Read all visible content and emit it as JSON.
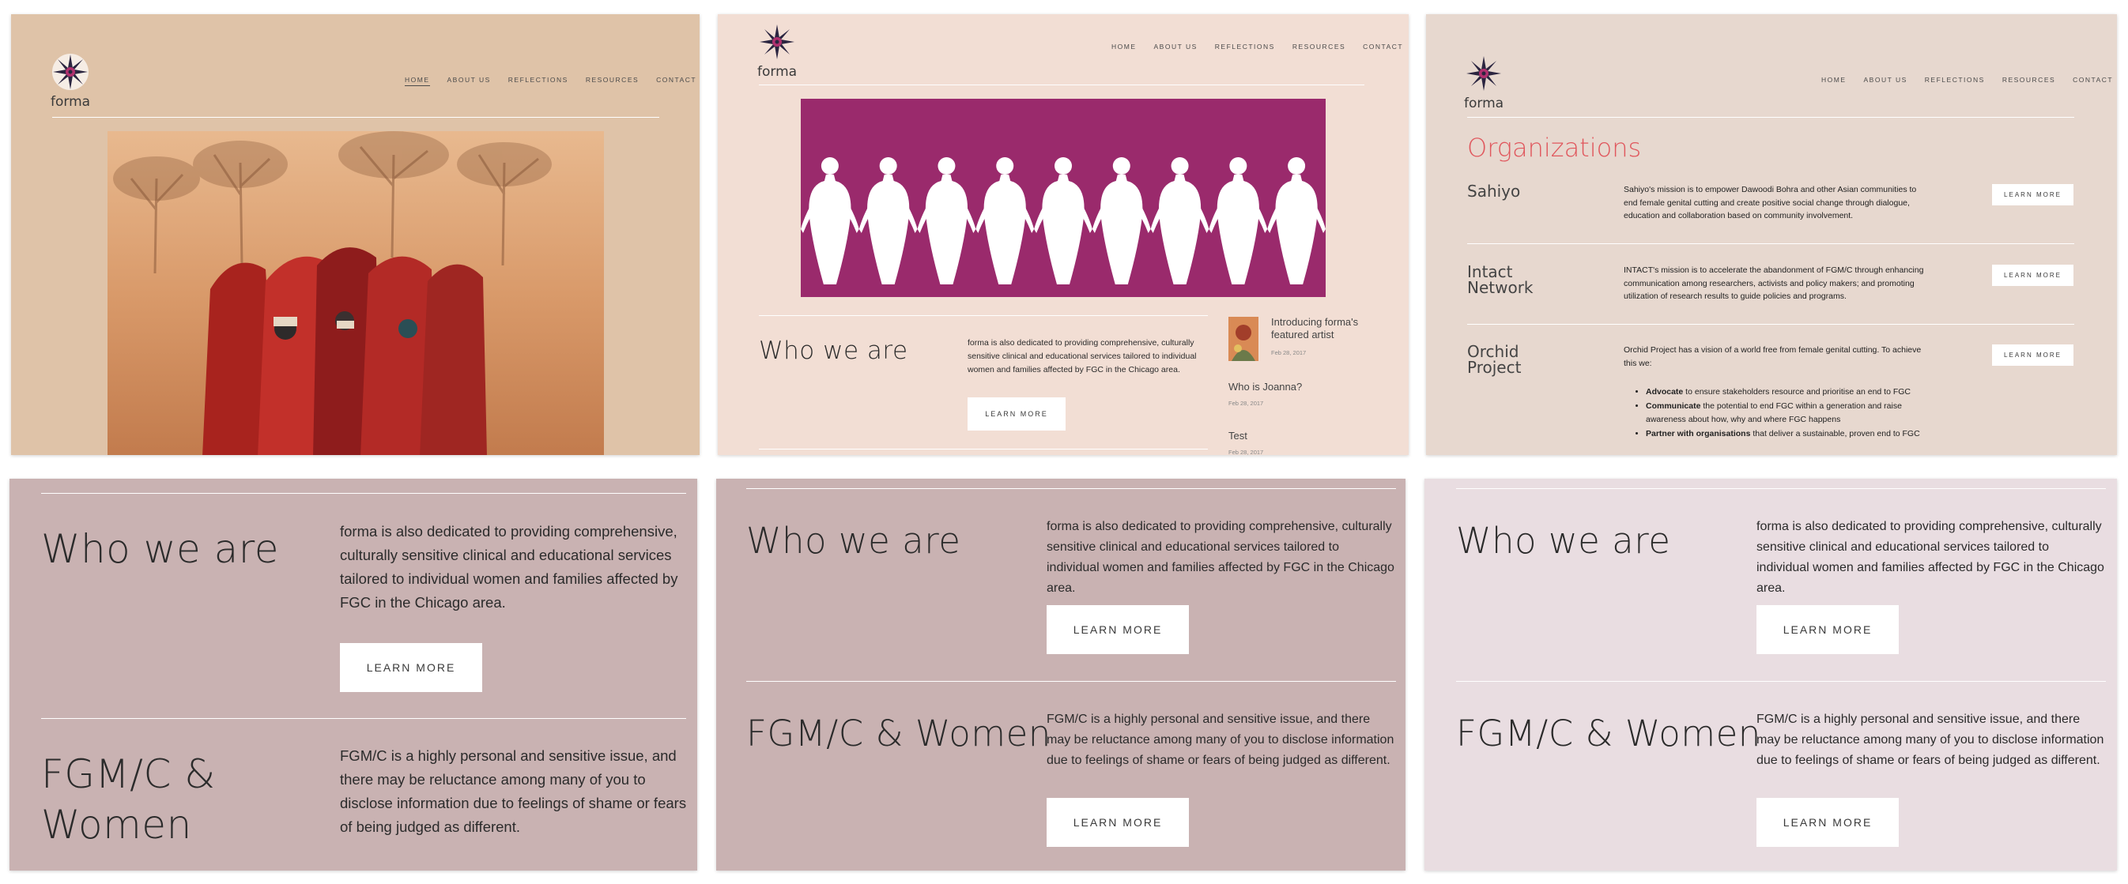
{
  "site": {
    "logo_text": "forma"
  },
  "nav": [
    "HOME",
    "ABOUT US",
    "REFLECTIONS",
    "RESOURCES",
    "CONTACT"
  ],
  "panel2": {
    "who_title": "Who we are",
    "who_body": "forma is also dedicated to providing comprehensive, culturally sensitive clinical and educational services tailored to individual women and families affected by FGC in the Chicago area.",
    "learn_more": "LEARN MORE",
    "posts": [
      {
        "title": "Introducing forma's featured artist",
        "date": "Feb 28, 2017"
      },
      {
        "title": "Who is Joanna?",
        "date": "Feb 28, 2017"
      },
      {
        "title": "Test",
        "date": "Feb 28, 2017"
      }
    ]
  },
  "panel3": {
    "title": "Organizations",
    "learn_more": "LEARN MORE",
    "orgs": [
      {
        "name_line1": "Sahiyo",
        "name_line2": "",
        "desc": "Sahiyo's mission is to empower Dawoodi Bohra and other Asian communities to end female genital cutting and create positive social change through dialogue, education and collaboration based on community involvement."
      },
      {
        "name_line1": "Intact",
        "name_line2": "Network",
        "desc": "INTACT's mission is to accelerate the abandonment of FGM/C through enhancing communication among researchers, activists and policy makers; and promoting utilization of research results to guide policies and programs."
      },
      {
        "name_line1": "Orchid",
        "name_line2": "Project",
        "desc": "Orchid Project has a vision of a world free from female genital cutting. To achieve this we:"
      }
    ],
    "bullets": [
      {
        "bold": "Advocate",
        "rest": " to ensure stakeholders resource and prioritise an end to FGC"
      },
      {
        "bold": "Communicate",
        "rest": " the potential to end FGC within a generation and raise awareness about how, why and where FGC happens"
      },
      {
        "bold": "Partner with organisations",
        "rest": " that deliver a sustainable, proven end to FGC"
      }
    ]
  },
  "sections": {
    "who_title": "Who we are",
    "who_body": "forma is also dedicated to providing comprehensive, culturally sensitive clinical and educational services tailored to individual women and families affected by FGC in the Chicago area.",
    "fgm_title": "FGM/C & Women",
    "fgm_title_line1": "FGM/C &",
    "fgm_title_line2": "Women",
    "fgm_body": "FGM/C is a highly personal and sensitive issue, and there may be reluctance among many of you to disclose information due to feelings of shame or fears of being judged as different.",
    "learn_more": "LEARN MORE"
  },
  "colors": {
    "panel1_bg": "#dfc3a8",
    "panel2_bg": "#f2ded4",
    "panel3_bg": "#e7d8cf",
    "mauve_bg": "#c9b2b2",
    "light_bg": "#e9dde1",
    "magenta_banner": "#9a2a6c",
    "org_title": "#e0575d"
  }
}
